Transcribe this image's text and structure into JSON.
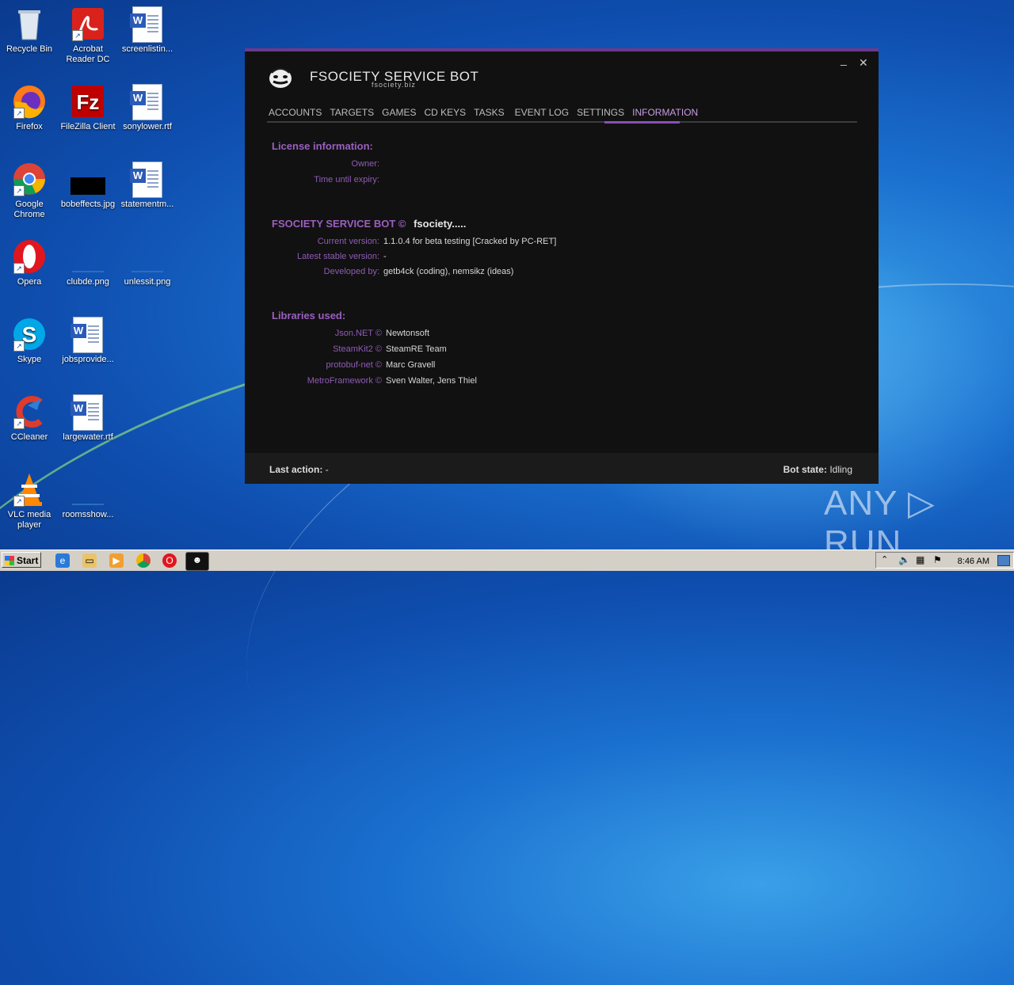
{
  "desktop": {
    "icons": [
      {
        "label": "Recycle Bin"
      },
      {
        "label": "Acrobat Reader DC"
      },
      {
        "label": "screenlistin..."
      },
      {
        "label": "Firefox"
      },
      {
        "label": "FileZilla Client"
      },
      {
        "label": "sonylower.rtf"
      },
      {
        "label": "Google Chrome"
      },
      {
        "label": "bobeffects.jpg"
      },
      {
        "label": "statementm..."
      },
      {
        "label": "Opera"
      },
      {
        "label": "clubde.png"
      },
      {
        "label": "unlessit.png"
      },
      {
        "label": "Skype"
      },
      {
        "label": "jobsprovide..."
      },
      {
        "label": "CCleaner"
      },
      {
        "label": "largewater.rtf"
      },
      {
        "label": "VLC media player"
      },
      {
        "label": "roomsshow..."
      }
    ]
  },
  "app": {
    "title": "FSOCIETY SERVICE BOT",
    "subtitle": "fsociety.biz",
    "minimize": "_",
    "close": "✕",
    "tabs": [
      {
        "label": "ACCOUNTS"
      },
      {
        "label": "TARGETS"
      },
      {
        "label": "GAMES"
      },
      {
        "label": "CD KEYS"
      },
      {
        "label": "TASKS"
      },
      {
        "label": "EVENT LOG"
      },
      {
        "label": "SETTINGS"
      },
      {
        "label": "INFORMATION"
      }
    ],
    "active_tab": "INFORMATION",
    "license": {
      "heading": "License information:",
      "owner_label": "Owner:",
      "expiry_label": "Time until expiry:"
    },
    "about": {
      "heading": "FSOCIETY SERVICE BOT ©",
      "heading_suffix": "fsociety.....",
      "current_version_label": "Current version:",
      "current_version": "1.1.0.4 for beta testing [Cracked by PC-RET]",
      "stable_version_label": "Latest stable version:",
      "stable_version": "-",
      "developed_label": "Developed by:",
      "developed": "getb4ck (coding), nemsikz (ideas)"
    },
    "libraries": {
      "heading": "Libraries used:",
      "items": [
        {
          "name": "Json.NET ©",
          "author": "Newtonsoft"
        },
        {
          "name": "SteamKit2 ©",
          "author": "SteamRE Team"
        },
        {
          "name": "protobuf-net ©",
          "author": "Marc Gravell"
        },
        {
          "name": "MetroFramework ©",
          "author": "Sven Walter, Jens Thiel"
        }
      ]
    },
    "status": {
      "last_action_label": "Last action:",
      "last_action": "-",
      "bot_state_label": "Bot state:",
      "bot_state": "Idling"
    }
  },
  "taskbar": {
    "start_label": "Start",
    "clock": "8:46 AM"
  },
  "watermark": "ANY ▷ RUN"
}
